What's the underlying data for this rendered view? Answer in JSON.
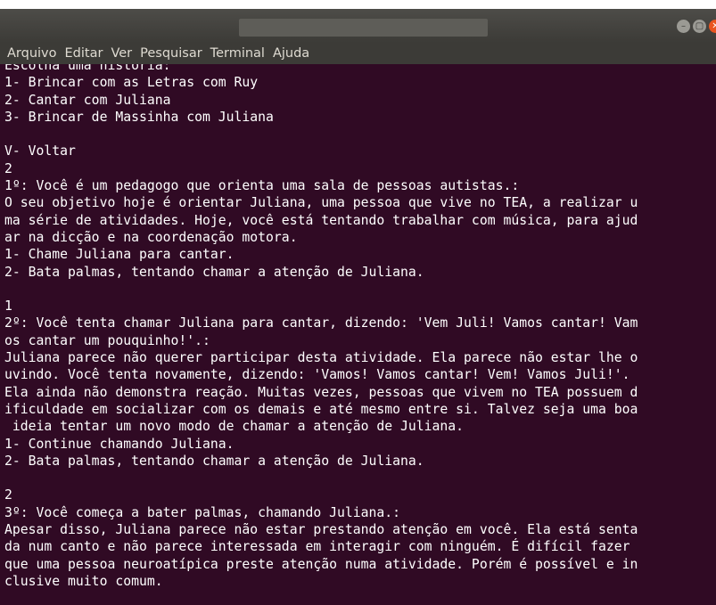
{
  "window": {
    "buttons": {
      "minimize": "–",
      "maximize": "▢",
      "close": "✕"
    }
  },
  "menu": [
    "Arquivo",
    "Editar",
    "Ver",
    "Pesquisar",
    "Terminal",
    "Ajuda"
  ],
  "terminal": {
    "lines": [
      "Escolha uma historia:",
      "1- Brincar com as Letras com Ruy",
      "2- Cantar com Juliana",
      "3- Brincar de Massinha com Juliana",
      "",
      "V- Voltar",
      "2",
      "1º: Você é um pedagogo que orienta uma sala de pessoas autistas.:",
      "O seu objetivo hoje é orientar Juliana, uma pessoa que vive no TEA, a realizar u",
      "ma série de atividades. Hoje, você está tentando trabalhar com música, para ajud",
      "ar na dicção e na coordenação motora.",
      "1- Chame Juliana para cantar.",
      "2- Bata palmas, tentando chamar a atenção de Juliana.",
      "",
      "1",
      "2º: Você tenta chamar Juliana para cantar, dizendo: 'Vem Juli! Vamos cantar! Vam",
      "os cantar um pouquinho!'.:",
      "Juliana parece não querer participar desta atividade. Ela parece não estar lhe o",
      "uvindo. Você tenta novamente, dizendo: 'Vamos! Vamos cantar! Vem! Vamos Juli!'.",
      "Ela ainda não demonstra reação. Muitas vezes, pessoas que vivem no TEA possuem d",
      "ificuldade em socializar com os demais e até mesmo entre si. Talvez seja uma boa",
      " ideia tentar um novo modo de chamar a atenção de Juliana.",
      "1- Continue chamando Juliana.",
      "2- Bata palmas, tentando chamar a atenção de Juliana.",
      "",
      "2",
      "3º: Você começa a bater palmas, chamando Juliana.:",
      "Apesar disso, Juliana parece não estar prestando atenção em você. Ela está senta",
      "da num canto e não parece interessada em interagir com ninguém. É difícil fazer",
      "que uma pessoa neuroatípica preste atenção numa atividade. Porém é possível e in",
      "clusive muito comum."
    ]
  }
}
